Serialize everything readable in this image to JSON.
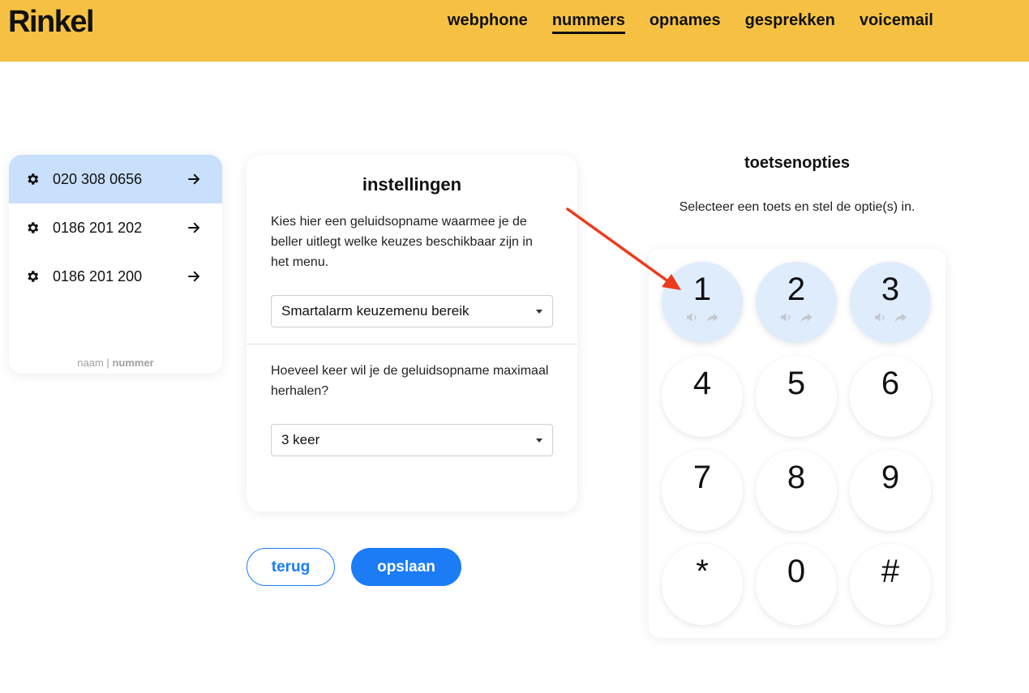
{
  "brand": {
    "logo": "Rinkel"
  },
  "nav": {
    "items": [
      {
        "label": "webphone",
        "active": false
      },
      {
        "label": "nummers",
        "active": true
      },
      {
        "label": "opnames",
        "active": false
      },
      {
        "label": "gesprekken",
        "active": false
      },
      {
        "label": "voicemail",
        "active": false
      }
    ]
  },
  "numbers": {
    "items": [
      {
        "label": "020 308 0656",
        "selected": true
      },
      {
        "label": "0186 201 202",
        "selected": false
      },
      {
        "label": "0186 201 200",
        "selected": false
      }
    ],
    "sort": {
      "name": "naam",
      "separator": "|",
      "number": "nummer"
    }
  },
  "settings": {
    "title": "instellingen",
    "recording_prompt": "Kies hier een geluidsopname waarmee je de beller uitlegt welke keuzes beschikbaar zijn in het menu.",
    "recording_value": "Smartalarm keuzemenu bereik",
    "repeat_prompt": "Hoeveel keer wil je de geluidsopname maximaal herhalen?",
    "repeat_value": "3 keer"
  },
  "buttons": {
    "back": "terug",
    "save": "opslaan"
  },
  "keypad": {
    "title": "toetsenopties",
    "subtitle": "Selecteer een toets en stel de optie(s) in.",
    "keys": [
      {
        "digit": "1",
        "configured": true
      },
      {
        "digit": "2",
        "configured": true
      },
      {
        "digit": "3",
        "configured": true
      },
      {
        "digit": "4",
        "configured": false
      },
      {
        "digit": "5",
        "configured": false
      },
      {
        "digit": "6",
        "configured": false
      },
      {
        "digit": "7",
        "configured": false
      },
      {
        "digit": "8",
        "configured": false
      },
      {
        "digit": "9",
        "configured": false
      },
      {
        "digit": "*",
        "configured": false
      },
      {
        "digit": "0",
        "configured": false
      },
      {
        "digit": "#",
        "configured": false
      }
    ]
  },
  "colors": {
    "header_bg": "#f6c143",
    "accent": "#1b7cf6",
    "selected_row": "#c8e0fb",
    "configured_key": "#dfecfc",
    "annotation_arrow": "#ee3a1c"
  },
  "icons": {
    "number_settings": "gear-icon",
    "number_open": "arrow-right-icon",
    "key_sound": "speaker-icon",
    "key_forward": "forward-icon"
  }
}
